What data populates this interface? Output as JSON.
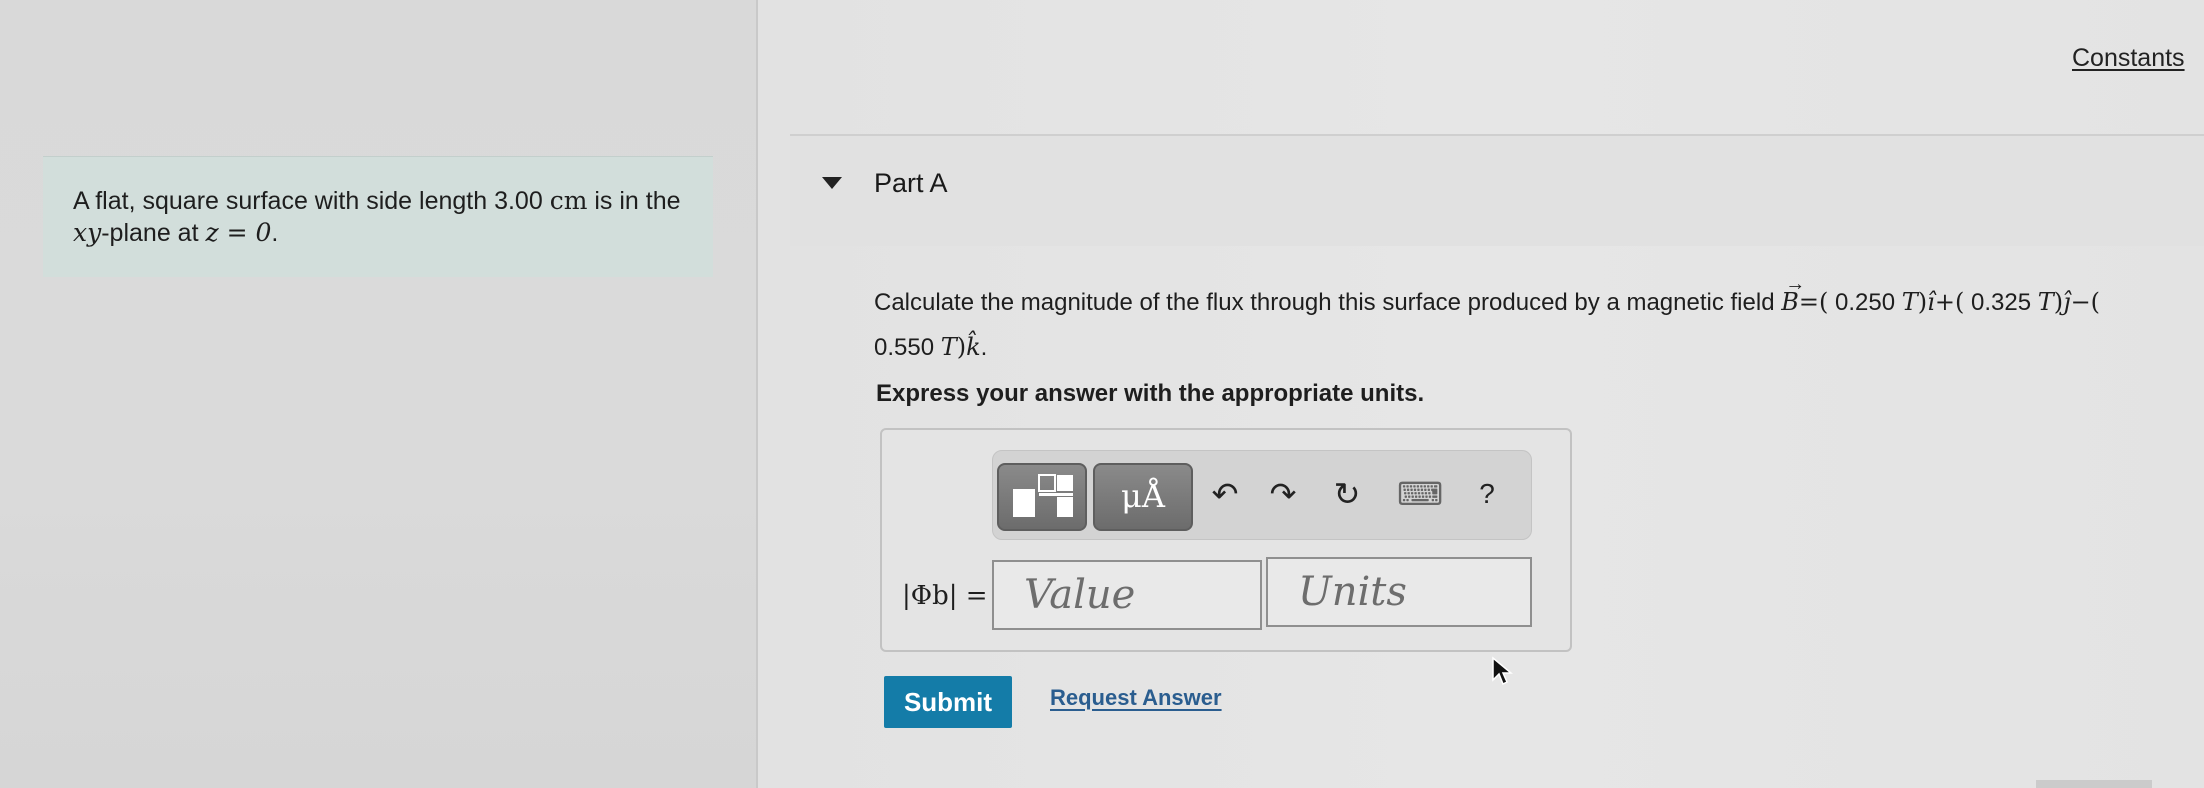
{
  "header": {
    "constants_label": "Constants"
  },
  "problem": {
    "text_a": "A flat, square surface with side length 3.00 ",
    "unit_cm": "cm",
    "text_b": " is in the ",
    "plane_var": "xy",
    "text_c": "-plane at ",
    "z_eq": "z = 0",
    "text_end": "."
  },
  "part": {
    "title": "Part A"
  },
  "question": {
    "intro": "Calculate the magnitude of the flux through this surface produced by a magnetic field ",
    "B": "B",
    "eq_open": "=(",
    "bx": " 0.250 ",
    "T": "T",
    "i_hat": "î",
    "plus": "+(",
    "by": " 0.325 ",
    "j_hat": "ĵ",
    "minus": "−(",
    "bz": "0.550 ",
    "k_hat": "k̂",
    "end": "."
  },
  "instruction": "Express your answer with the appropriate units.",
  "toolbar": {
    "units_label": "μÅ",
    "undo_glyph": "↶",
    "redo_glyph": "↷",
    "reset_glyph": "↻",
    "keyboard_glyph": "⌨",
    "help_glyph": "?"
  },
  "answer": {
    "label": "|Φb| =",
    "value_placeholder": "Value",
    "units_placeholder": "Units"
  },
  "actions": {
    "submit_label": "Submit",
    "request_label": "Request Answer"
  }
}
